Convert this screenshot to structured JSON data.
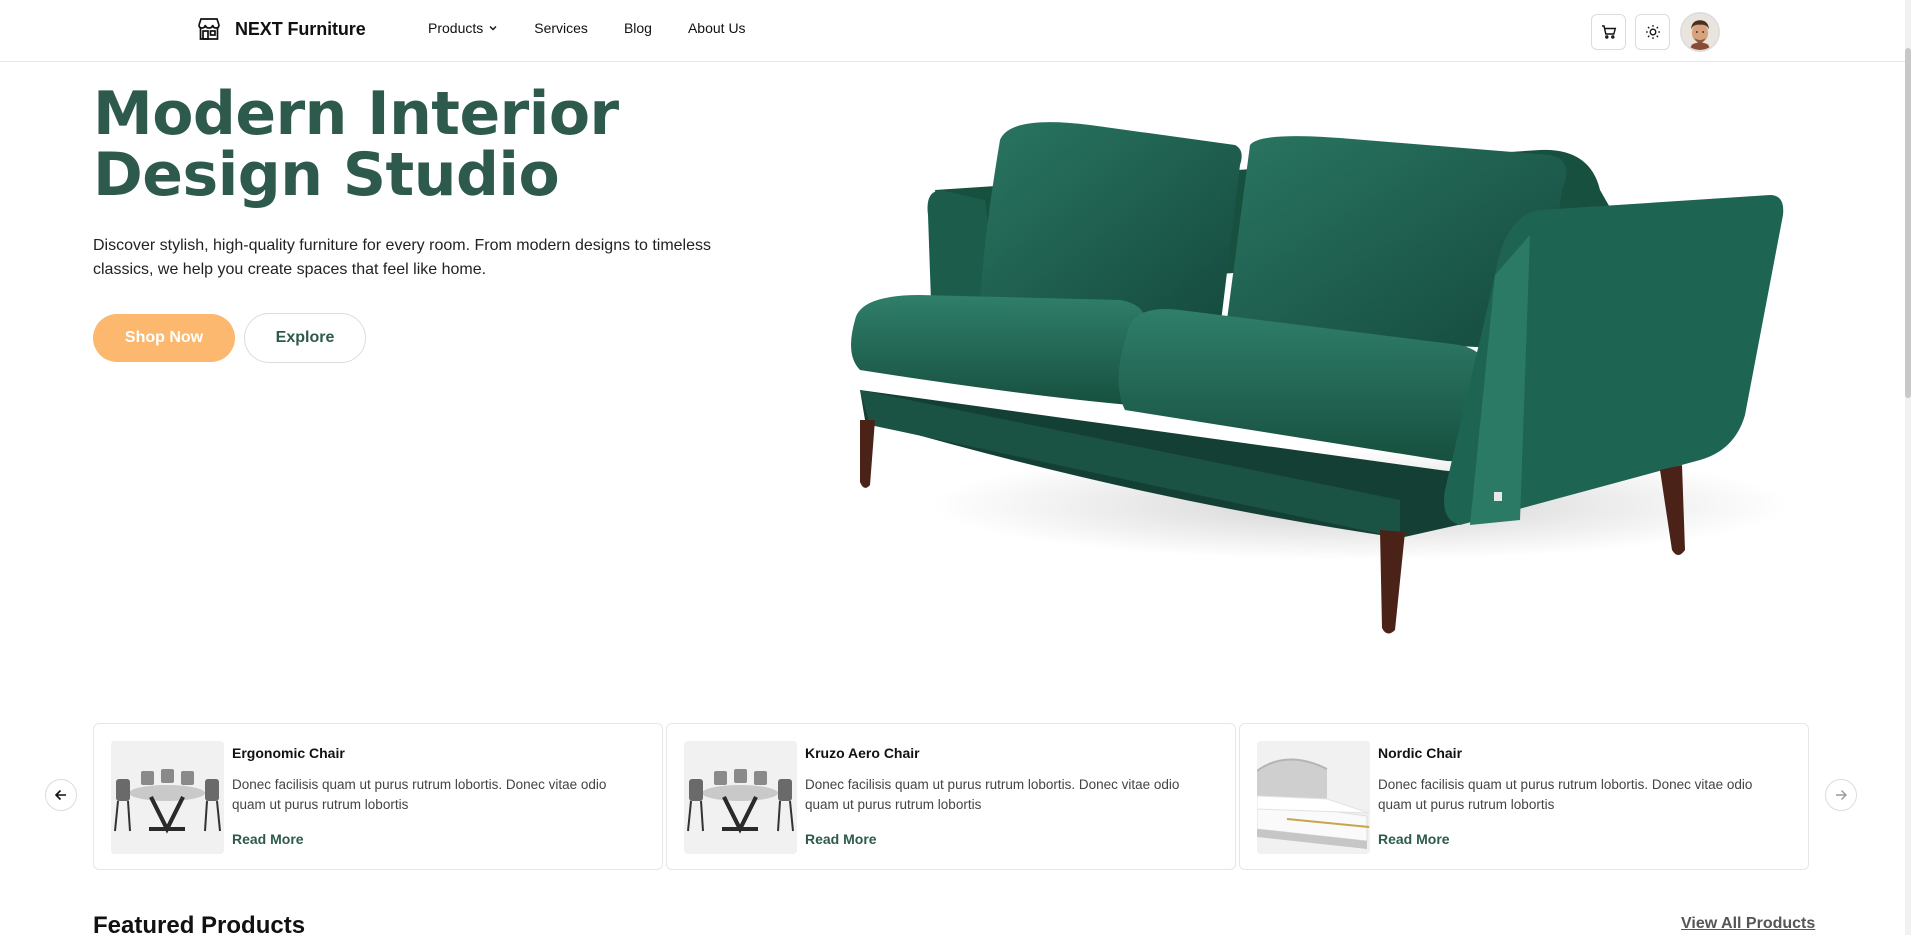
{
  "brand": {
    "name": "NEXT Furniture",
    "logo_icon": "store-icon"
  },
  "nav": {
    "items": [
      {
        "label": "Products",
        "has_dropdown": true
      },
      {
        "label": "Services"
      },
      {
        "label": "Blog"
      },
      {
        "label": "About Us"
      }
    ]
  },
  "header_actions": {
    "cart_icon": "cart-icon",
    "theme_icon": "sun-icon",
    "avatar": "user-avatar"
  },
  "hero": {
    "title_line1": "Modern Interior",
    "title_line2": "Design Studio",
    "description": "Discover stylish, high-quality furniture for every room. From modern designs to timeless classics, we help you create spaces that feel like home.",
    "primary_button": "Shop Now",
    "secondary_button": "Explore",
    "image": "green-velvet-sofa"
  },
  "carousel": {
    "prev_icon": "arrow-left-icon",
    "next_icon": "arrow-right-icon",
    "cards": [
      {
        "title": "Ergonomic Chair",
        "description": "Donec facilisis quam ut purus rutrum lobortis. Donec vitae odio quam ut purus rutrum lobortis",
        "link": "Read More",
        "image": "dining-table-set"
      },
      {
        "title": "Kruzo Aero Chair",
        "description": "Donec facilisis quam ut purus rutrum lobortis. Donec vitae odio quam ut purus rutrum lobortis",
        "link": "Read More",
        "image": "dining-table-set"
      },
      {
        "title": "Nordic Chair",
        "description": "Donec facilisis quam ut purus rutrum lobortis. Donec vitae odio quam ut purus rutrum lobortis",
        "link": "Read More",
        "image": "upholstered-bed"
      }
    ]
  },
  "featured": {
    "title": "Featured Products",
    "view_all": "View All Products"
  },
  "colors": {
    "brand_green": "#2d5a4c",
    "accent_orange": "#fbb86e",
    "sofa_green": "#1f5c4e"
  }
}
